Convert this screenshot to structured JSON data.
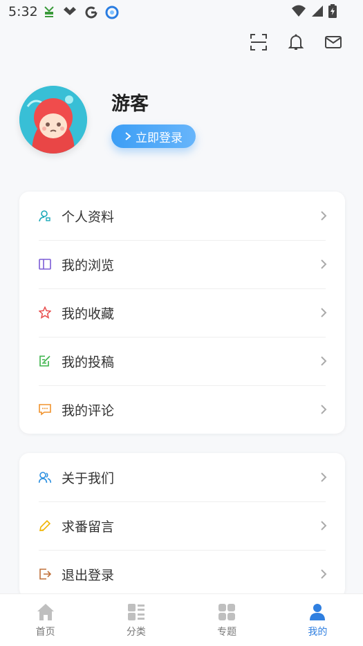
{
  "status_bar": {
    "time": "5:32"
  },
  "profile": {
    "username": "游客",
    "login_label": "立即登录"
  },
  "menu_group_1": [
    {
      "label": "个人资料",
      "icon": "user-icon",
      "color": "#1aa9b8"
    },
    {
      "label": "我的浏览",
      "icon": "book-icon",
      "color": "#7b5bd6"
    },
    {
      "label": "我的收藏",
      "icon": "star-icon",
      "color": "#e84d4d"
    },
    {
      "label": "我的投稿",
      "icon": "edit-icon",
      "color": "#3bb34a"
    },
    {
      "label": "我的评论",
      "icon": "comment-icon",
      "color": "#f0922c"
    }
  ],
  "menu_group_2": [
    {
      "label": "关于我们",
      "icon": "users-icon",
      "color": "#2a8fe0"
    },
    {
      "label": "求番留言",
      "icon": "pencil-icon",
      "color": "#f0b400"
    },
    {
      "label": "退出登录",
      "icon": "logout-icon",
      "color": "#c0703a"
    }
  ],
  "tabbar": [
    {
      "label": "首页",
      "icon": "home-icon"
    },
    {
      "label": "分类",
      "icon": "category-icon"
    },
    {
      "label": "专题",
      "icon": "topics-icon"
    },
    {
      "label": "我的",
      "icon": "profile-icon",
      "active": true
    }
  ],
  "colors": {
    "accent": "#3c9ef5",
    "active_tab": "#2f7fe0"
  }
}
